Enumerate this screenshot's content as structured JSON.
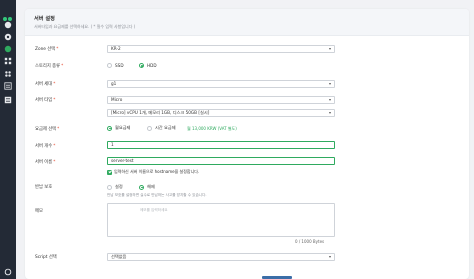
{
  "panel": {
    "title": "서버 설정",
    "subtitle": "서버타입과 요금제를 선택하세요. ( * 필수 입력 사항입니다 )"
  },
  "fields": {
    "zone": {
      "label": "Zone 선택",
      "value": "KR-2"
    },
    "storage": {
      "label": "스토리지 종류",
      "options": [
        "SSD",
        "HDD"
      ],
      "selected": "HDD"
    },
    "generation": {
      "label": "서버 세대",
      "value": "g1"
    },
    "server_type": {
      "label": "서버 타입",
      "value": "Micro"
    },
    "spec": {
      "value": "[Micro] vCPU 1개, 메모리 1GB, 디스크 50GB [실시]"
    },
    "billing": {
      "label": "요금제 선택",
      "options": [
        "월요금제",
        "시간 요금제"
      ],
      "selected": "월요금제",
      "note": "월 13,000 KRW (VAT 별도)"
    },
    "count": {
      "label": "서버 개수",
      "value": "1"
    },
    "name": {
      "label": "서버 이름",
      "value": "server-test"
    },
    "hostname_check": {
      "label": "입력하신 서버 이름으로 hostname을 설정합니다."
    },
    "protection": {
      "label": "반납 보호",
      "options": [
        "설정",
        "해제"
      ],
      "selected": "해제",
      "hint": "반납 보호를 설정하면 실수로 반납하는 사고를 방지할 수 있습니다."
    },
    "memo": {
      "label": "메모",
      "placeholder": "메모를 입력하세요",
      "counter": "0 / 1000 Bytes"
    },
    "script": {
      "label": "Script 선택",
      "value": "선택없음"
    }
  },
  "colors": {
    "accent": "#2faa5f",
    "sidebar": "#232a36",
    "required": "#e5462d"
  },
  "icons": [
    "logo-icon",
    "cloud-icon",
    "settings-icon",
    "storage-icon",
    "grid-icon",
    "network-icon",
    "list-icon",
    "server-icon",
    "power-icon"
  ]
}
